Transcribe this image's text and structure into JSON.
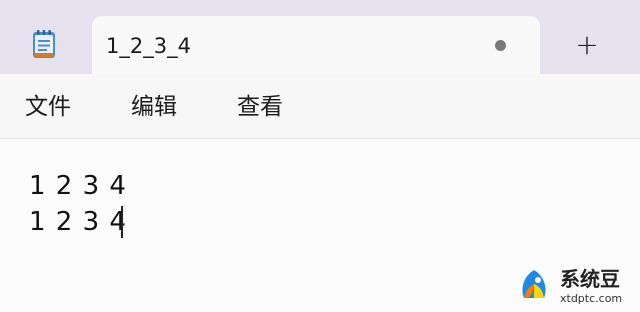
{
  "tabbar": {
    "app_icon": "notepad-icon",
    "tab_title": "1_2_3_4",
    "unsaved_indicator": "dot",
    "new_tab_label": "+"
  },
  "menubar": {
    "items": [
      {
        "label": "文件"
      },
      {
        "label": "编辑"
      },
      {
        "label": "查看"
      }
    ]
  },
  "editor": {
    "lines": [
      "1 2 3 4",
      "1 2 3 4"
    ]
  },
  "watermark": {
    "name": "系统豆",
    "domain": "xtdptc.com"
  },
  "colors": {
    "tabbar_bg": "#e6e1ee",
    "tab_bg": "#f9f9f9",
    "menubar_bg": "#f7f7f7",
    "editor_bg": "#fbfbfb",
    "logo_blue": "#1e88e5",
    "logo_orange": "#f57c00",
    "logo_yellow": "#ffd600"
  }
}
